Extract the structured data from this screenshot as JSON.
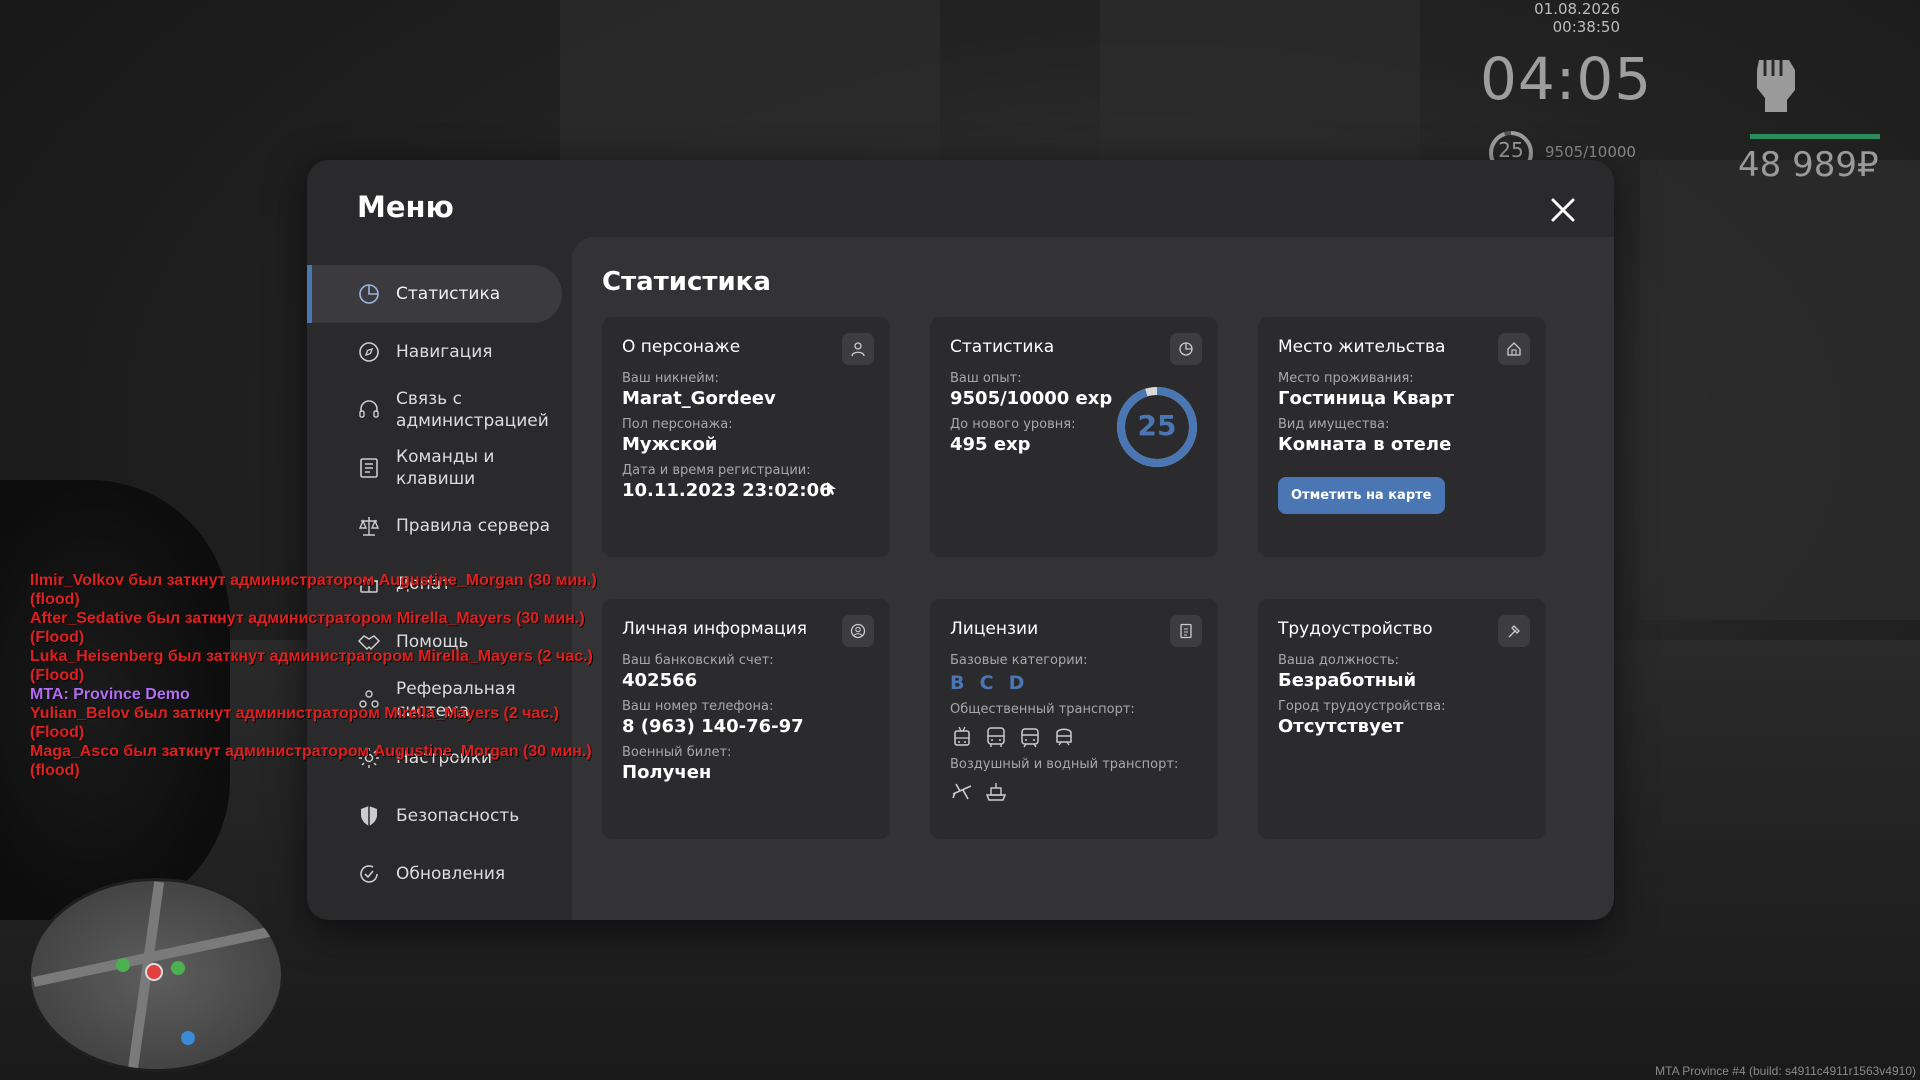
{
  "hud": {
    "datetime": "01.08.2026 00:38:50",
    "time": "04:05",
    "level": "25",
    "exp": "9505/10000",
    "money": "48 989₽"
  },
  "menu": {
    "title": "Меню",
    "nav": [
      {
        "label": "Статистика",
        "icon": "chart-pie-icon",
        "active": true
      },
      {
        "label": "Навигация",
        "icon": "compass-icon"
      },
      {
        "label": "Связь с администрацией",
        "icon": "headset-icon"
      },
      {
        "label": "Команды и клавиши",
        "icon": "document-list-icon"
      },
      {
        "label": "Правила сервера",
        "icon": "scales-icon"
      },
      {
        "label": "Донат",
        "icon": "gift-icon"
      },
      {
        "label": "Помощь",
        "icon": "handshake-icon"
      },
      {
        "label": "Реферальная система",
        "icon": "people-icon"
      },
      {
        "label": "Настройки",
        "icon": "gear-icon"
      },
      {
        "label": "Безопасность",
        "icon": "shield-icon"
      },
      {
        "label": "Обновления",
        "icon": "refresh-check-icon"
      }
    ]
  },
  "content": {
    "title": "Статистика",
    "character": {
      "title": "О персонаже",
      "nick_label": "Ваш никнейм:",
      "nick": "Marat_Gordeev",
      "gender_label": "Пол персонажа:",
      "gender": "Мужской",
      "reg_label": "Дата и время регистрации:",
      "reg": "10.11.2023 23:02:06"
    },
    "stats": {
      "title": "Статистика",
      "exp_label": "Ваш опыт:",
      "exp": "9505/10000 exp",
      "next_label": "До нового уровня:",
      "next": "495 exp",
      "level": "25",
      "progress": 0.9505
    },
    "residence": {
      "title": "Место жительства",
      "place_label": "Место проживания:",
      "place": "Гостиница Кварт",
      "type_label": "Вид имущества:",
      "type": "Комната в отеле",
      "button": "Отметить на карте"
    },
    "personal": {
      "title": "Личная информация",
      "bank_label": "Ваш банковский счет:",
      "bank": "402566",
      "phone_label": "Ваш номер телефона:",
      "phone": "8 (963) 140-76-97",
      "military_label": "Военный билет:",
      "military": "Получен"
    },
    "licenses": {
      "title": "Лицензии",
      "base_label": "Базовые категории:",
      "base": [
        "B",
        "C",
        "D"
      ],
      "public_label": "Общественный транспорт:",
      "public_icons": [
        "trolleybus-icon",
        "bus-icon",
        "tram-icon",
        "train-icon"
      ],
      "airwater_label": "Воздушный и водный транспорт:",
      "airwater_icons": [
        "plane-icon",
        "boat-icon"
      ]
    },
    "job": {
      "title": "Трудоустройство",
      "position_label": "Ваша должность:",
      "position": "Безработный",
      "city_label": "Город трудоустройства:",
      "city": "Отсутствует"
    }
  },
  "chat": [
    {
      "text": "Ilmir_Volkov был заткнут администратором Augustine_Morgan (30 мин.)"
    },
    {
      "text": "(flood)"
    },
    {
      "text": "After_Sedative был заткнут администратором Mirella_Mayers (30 мин.)"
    },
    {
      "text": "(Flood)"
    },
    {
      "text": "Luka_Heisenberg был заткнут администратором Mirella_Mayers (2 час.)"
    },
    {
      "text": "(Flood)"
    },
    {
      "text": "MTA: Province Demo",
      "mta": true
    },
    {
      "text": "Yulian_Belov был заткнут администратором Mirella_Mayers (2 час.)"
    },
    {
      "text": "(Flood)"
    },
    {
      "text": "Maga_Asco был заткнут администратором Augustine_Morgan (30 мин.)"
    },
    {
      "text": "(flood)"
    }
  ],
  "build": "MTA Province #4 (build: s4911c4911r1563v4910)"
}
